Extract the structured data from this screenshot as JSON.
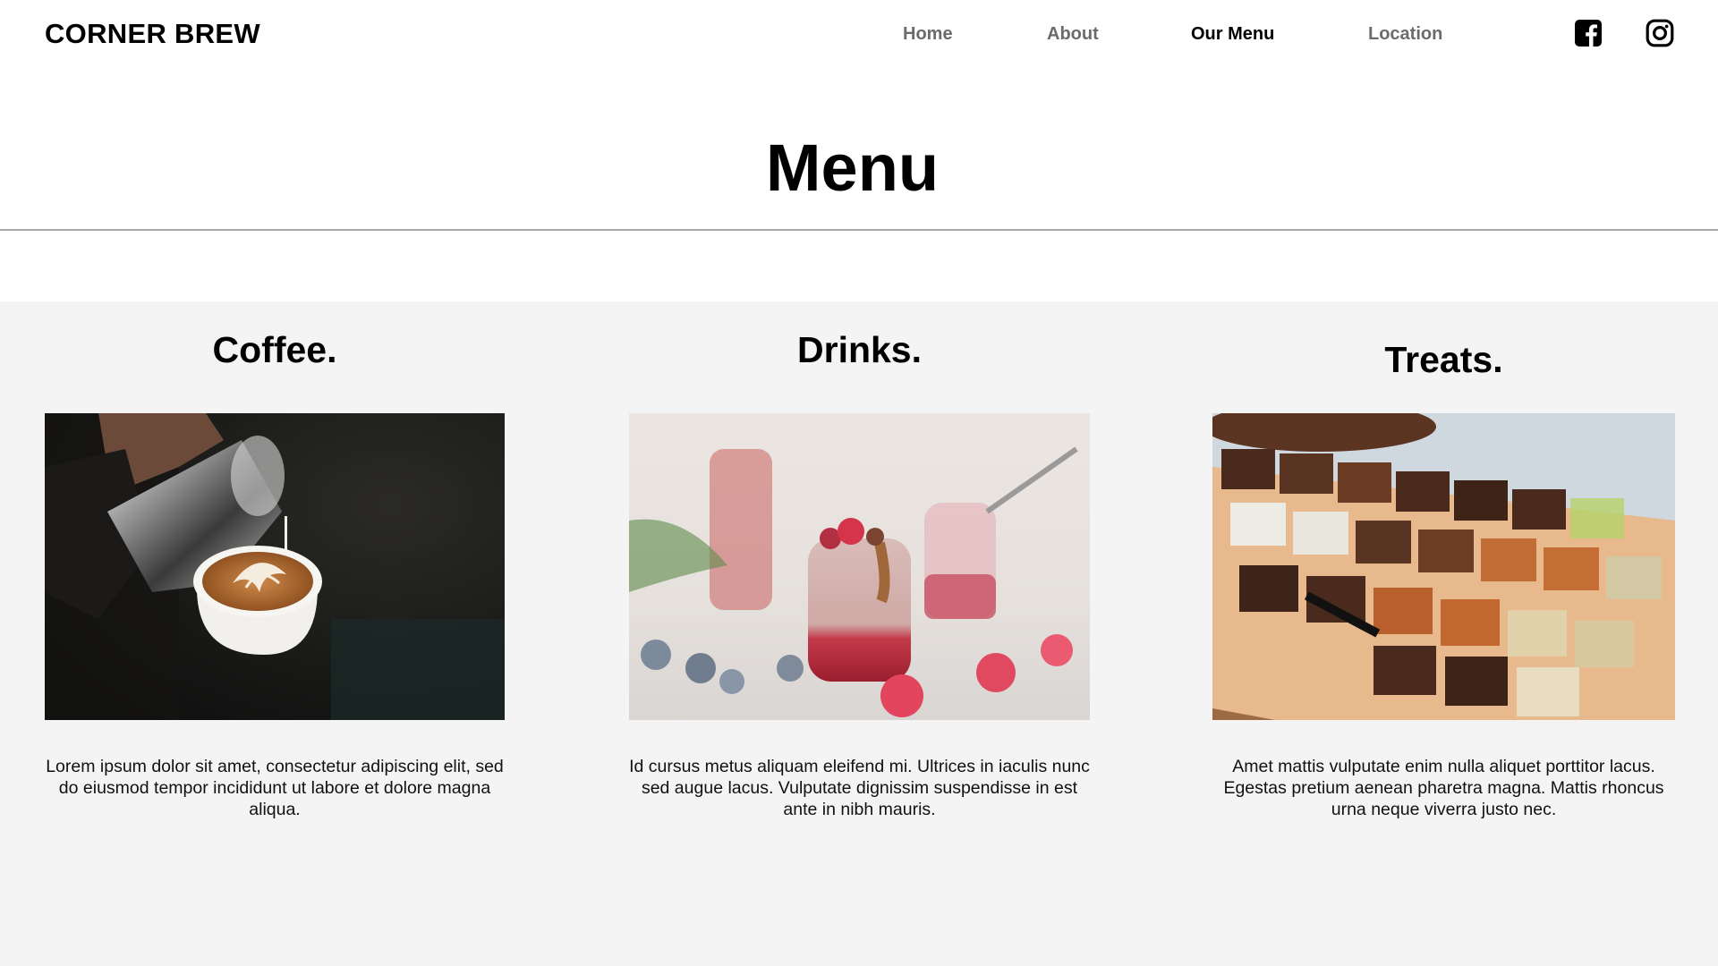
{
  "header": {
    "brand": "CORNER BREW",
    "nav": [
      {
        "label": "Home",
        "active": false
      },
      {
        "label": "About",
        "active": false
      },
      {
        "label": "Our Menu",
        "active": true
      },
      {
        "label": "Location",
        "active": false
      }
    ],
    "social": [
      {
        "icon": "facebook-icon"
      },
      {
        "icon": "instagram-icon"
      }
    ]
  },
  "page": {
    "title": "Menu"
  },
  "categories": [
    {
      "title": "Coffee.",
      "image": "latte-art-pour-photo",
      "description": "Lorem ipsum dolor sit amet, consectetur adipiscing elit, sed do eiusmod tempor incididunt ut labore et dolore magna aliqua."
    },
    {
      "title": "Drinks.",
      "image": "berry-smoothie-jars-photo",
      "description": "Id cursus metus aliquam eleifend mi. Ultrices in iaculis nunc sed augue lacus. Vulputate dignissim suspendisse in est ante in nibh mauris."
    },
    {
      "title": "Treats.",
      "image": "brownie-tray-photo",
      "description": "Amet mattis vulputate enim nulla aliquet porttitor lacus. Egestas pretium aenean pharetra magna. Mattis rhoncus urna neque viverra justo nec."
    }
  ],
  "colors": {
    "nav_inactive": "#6b6b6b",
    "nav_active": "#000000",
    "section_bg": "#f4f4f4",
    "rule": "#a8a8a8"
  }
}
